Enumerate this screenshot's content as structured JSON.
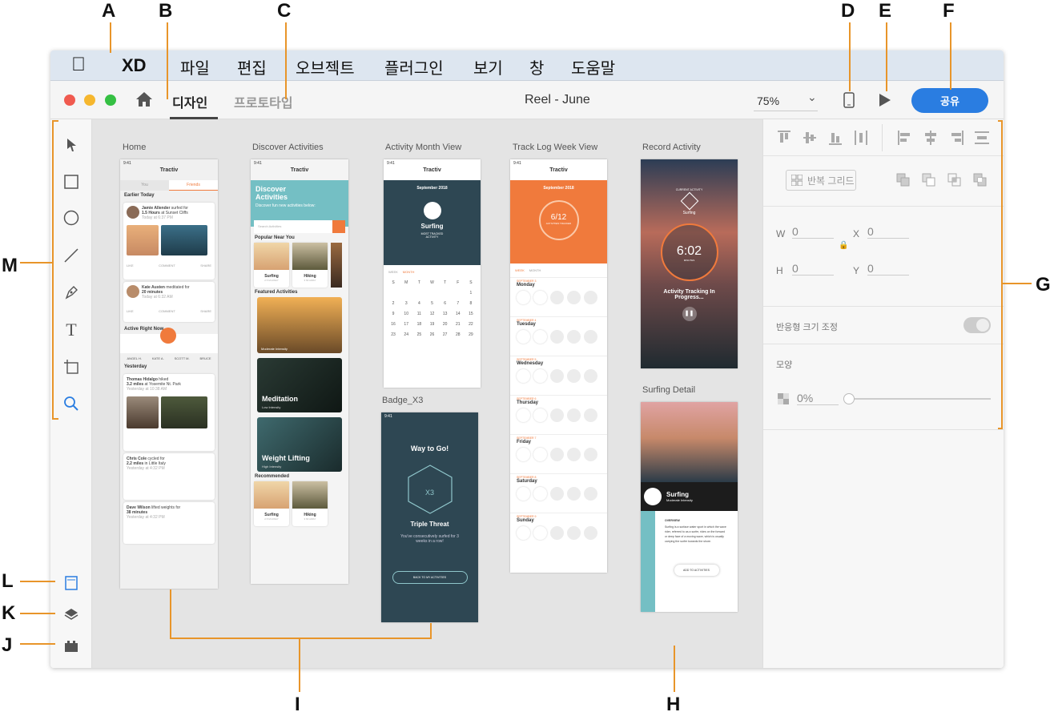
{
  "callouts": {
    "a": "A",
    "b": "B",
    "c": "C",
    "d": "D",
    "e": "E",
    "f": "F",
    "g": "G",
    "h": "H",
    "i": "I",
    "j": "J",
    "k": "K",
    "l": "L",
    "m": "M"
  },
  "menubar": {
    "app": "XD",
    "items": [
      "파일",
      "편집",
      "오브젝트",
      "플러그인",
      "보기",
      "창",
      "도움말"
    ]
  },
  "titlebar": {
    "tab_design": "디자인",
    "tab_prototype": "프로토타입",
    "doc_title": "Reel - June",
    "zoom": "75%",
    "share": "공유"
  },
  "artboards": {
    "home": {
      "label": "Home",
      "time": "9:41",
      "app_title": "Tractiv",
      "tab_you": "You",
      "tab_friends": "Friends",
      "earlier": "Earlier Today",
      "yesterday": "Yesterday",
      "active": "Active Right Now",
      "posts": [
        {
          "name": "Jamie Allender",
          "action": "surfed for",
          "detail": "1.5 Hours",
          "place": "at Sunset Cliffs",
          "time": "Today at 6:37 PM"
        },
        {
          "name": "Kate Austen",
          "action": "meditated for",
          "detail": "20 minutes",
          "place": "",
          "time": "Today at 6:32 AM"
        },
        {
          "name": "Thomas Hidalgo",
          "action": "hiked",
          "detail": "3.2 miles",
          "place": "at Yosemite Nt. Park",
          "time": "Yesterday at 10:38 AM"
        },
        {
          "name": "Chris Cole",
          "action": "cycled for",
          "detail": "2.2 miles",
          "place": "in Little Italy",
          "time": "Yesterday at 4:32 PM"
        },
        {
          "name": "Dave Wilson",
          "action": "lifted weights for",
          "detail": "38 minutes",
          "place": "",
          "time": "Yesterday at 4:32 PM"
        }
      ],
      "actions": [
        "LIKE",
        "COMMENT",
        "SHARE"
      ],
      "friends": [
        "ANGEL H.",
        "KATE A.",
        "SCOTT M.",
        "BRUCE"
      ]
    },
    "discover": {
      "label": "Discover Activities",
      "title": "Discover Activities",
      "subtitle": "Discover fun new activities below:",
      "search": "Search Activities",
      "popular": "Popular Near You",
      "see_all": "See All Activities",
      "popular_items": [
        {
          "name": "Surfing",
          "sub": "2.5 MI AWAY"
        },
        {
          "name": "Hiking",
          "sub": "3 MI AWAY"
        }
      ],
      "featured": "Featured Activities",
      "featured_items": [
        {
          "name": "",
          "sub": "Moderate Intensity"
        },
        {
          "name": "Meditation",
          "sub": "Low Intensity"
        },
        {
          "name": "Weight Lifting",
          "sub": "High Intensity"
        }
      ],
      "recommended": "Recommended",
      "rec_items": [
        {
          "name": "Surfing",
          "sub": "2.5 MI AWAY"
        },
        {
          "name": "Hiking",
          "sub": "3 MI AWAY"
        }
      ]
    },
    "month": {
      "label": "Activity Month View",
      "month": "September 2018",
      "activity": "Surfing",
      "most": "MOST TRACKED ACTIVITY",
      "week": "WEEK",
      "month_tab": "MONTH",
      "days": [
        "S",
        "M",
        "T",
        "W",
        "T",
        "F",
        "S"
      ],
      "dates": [
        "",
        "",
        "",
        "",
        "",
        "",
        "1",
        "2",
        "3",
        "4",
        "5",
        "6",
        "7",
        "8",
        "9",
        "10",
        "11",
        "12",
        "13",
        "14",
        "15",
        "16",
        "17",
        "18",
        "19",
        "20",
        "21",
        "22",
        "23",
        "24",
        "25",
        "26",
        "27",
        "28",
        "29"
      ]
    },
    "badge": {
      "label": "Badge_X3",
      "time": "9:41",
      "title": "Way to Go!",
      "badge": "X3",
      "name": "Triple Threat",
      "desc": "You've consecutively surfed for 3 weeks in a row!",
      "button": "BACK TO MY ACTIVITIES"
    },
    "weeklog": {
      "label": "Track Log Week View",
      "month": "September 2018",
      "count": "6/12",
      "count_sub": "ACTIVITIES TRACKED",
      "week": "WEEK",
      "month_tab": "MONTH",
      "days": [
        {
          "date": "SEPTEMBER 3",
          "day": "Monday"
        },
        {
          "date": "SEPTEMBER 4",
          "day": "Tuesday"
        },
        {
          "date": "SEPTEMBER 5",
          "day": "Wednesday"
        },
        {
          "date": "SEPTEMBER 6",
          "day": "Thursday"
        },
        {
          "date": "SEPTEMBER 7",
          "day": "Friday"
        },
        {
          "date": "SEPTEMBER 8",
          "day": "Saturday"
        },
        {
          "date": "SEPTEMBER 9",
          "day": "Sunday"
        }
      ],
      "time_a": "6:00AM",
      "time_b": "11:00AM"
    },
    "record": {
      "label": "Record Activity",
      "current": "CURRENT ACTIVITY",
      "activity": "Surfing",
      "timer": "6:02",
      "minutes": "MINUTES",
      "status": "Activity Tracking In Progress..."
    },
    "detail": {
      "label": "Surfing Detail",
      "name": "Surfing",
      "intensity": "Moderate Intensity",
      "overview": "OVERVIEW",
      "desc": "Surfing is a surface water sport in which the wave rider, referred to as a surfer, rides on the forward or deep face of a moving wave, which is usually carrying the surfer towards the shore.",
      "button": "ADD TO ACTIVITIES"
    }
  },
  "inspector": {
    "repeat_grid": "반복 그리드",
    "w": "W",
    "h": "H",
    "x": "X",
    "y": "Y",
    "w_val": "0",
    "h_val": "0",
    "x_val": "0",
    "y_val": "0",
    "responsive": "반응형 크기 조정",
    "appearance": "모양",
    "opacity": "0%"
  },
  "colors": {
    "accent": "#e8952a",
    "brand": "#f07a3c",
    "teal": "#74bfc4",
    "dark": "#2e4753",
    "share": "#2a7de1"
  }
}
